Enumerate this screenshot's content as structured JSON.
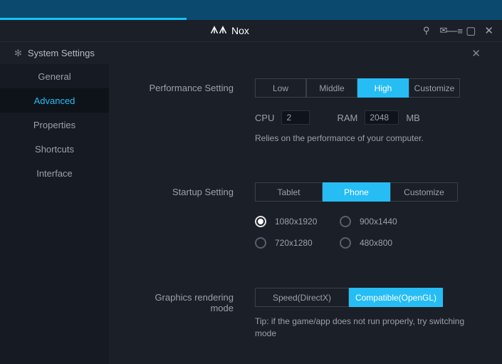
{
  "titlebar": {
    "app_name": "Nox"
  },
  "settings": {
    "title": "System Settings"
  },
  "sidebar": {
    "items": [
      {
        "label": "General"
      },
      {
        "label": "Advanced"
      },
      {
        "label": "Properties"
      },
      {
        "label": "Shortcuts"
      },
      {
        "label": "Interface"
      }
    ]
  },
  "performance": {
    "title": "Performance Setting",
    "options": [
      "Low",
      "Middle",
      "High",
      "Customize"
    ],
    "cpu_label": "CPU",
    "cpu_value": "2",
    "ram_label": "RAM",
    "ram_value": "2048",
    "ram_unit": "MB",
    "hint": "Relies on the performance of your computer."
  },
  "startup": {
    "title": "Startup Setting",
    "options": [
      "Tablet",
      "Phone",
      "Customize"
    ],
    "resolutions": [
      "1080x1920",
      "900x1440",
      "720x1280",
      "480x800"
    ]
  },
  "graphics": {
    "title": "Graphics rendering mode",
    "options": [
      "Speed(DirectX)",
      "Compatible(OpenGL)"
    ],
    "tip": "Tip: if the game/app does not run properly, try switching mode"
  }
}
